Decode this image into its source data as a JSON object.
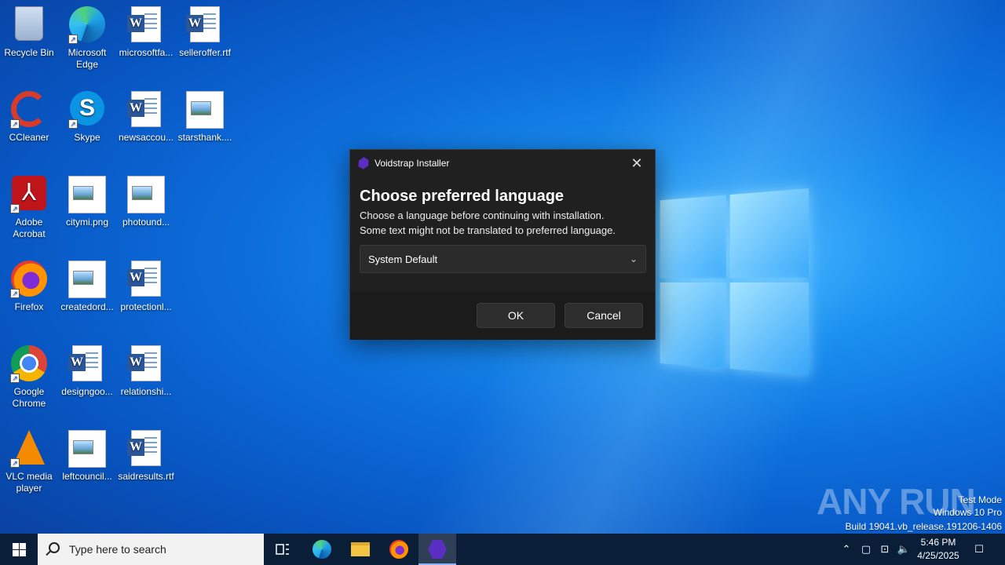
{
  "desktop": {
    "icons": [
      {
        "label": "Recycle Bin",
        "type": "recycle-bin-icon"
      },
      {
        "label": "Microsoft Edge",
        "type": "edge-icon"
      },
      {
        "label": "microsoftfa...",
        "type": "word-document-icon"
      },
      {
        "label": "selleroffer.rtf",
        "type": "word-document-icon"
      },
      {
        "label": "CCleaner",
        "type": "ccleaner-icon"
      },
      {
        "label": "Skype",
        "type": "skype-icon"
      },
      {
        "label": "newsaccou...",
        "type": "word-document-icon"
      },
      {
        "label": "starsthank....",
        "type": "image-file-icon"
      },
      {
        "label": "Adobe Acrobat",
        "type": "acrobat-icon"
      },
      {
        "label": "citymi.png",
        "type": "image-file-icon"
      },
      {
        "label": "photound...",
        "type": "image-file-icon"
      },
      {
        "label": "Firefox",
        "type": "firefox-icon"
      },
      {
        "label": "createdord...",
        "type": "image-file-icon"
      },
      {
        "label": "protectionl...",
        "type": "word-document-icon"
      },
      {
        "label": "Google Chrome",
        "type": "chrome-icon"
      },
      {
        "label": "designgoo...",
        "type": "word-document-icon"
      },
      {
        "label": "relationshi...",
        "type": "word-document-icon"
      },
      {
        "label": "VLC media player",
        "type": "vlc-icon"
      },
      {
        "label": "leftcouncil...",
        "type": "image-file-icon"
      },
      {
        "label": "saidresults.rtf",
        "type": "word-document-icon"
      }
    ]
  },
  "dialog": {
    "title": "Voidstrap Installer",
    "heading": "Choose preferred language",
    "line1": "Choose a language before continuing with installation.",
    "line2": "Some text might not be translated to preferred language.",
    "language_select": "System Default",
    "ok_label": "OK",
    "cancel_label": "Cancel"
  },
  "watermark": {
    "brand": "ANY RUN",
    "test_mode": "Test Mode",
    "edition": "Windows 10 Pro",
    "build": "Build 19041.vb_release.191206-1406"
  },
  "taskbar": {
    "search_placeholder": "Type here to search",
    "time": "5:46 PM",
    "date": "4/25/2025"
  },
  "colors": {
    "desktop_blue": "#0d6fdc",
    "dialog_bg": "#202020",
    "taskbar_bg": "#0b1e38",
    "voidstrap_accent": "#5b2ec2"
  }
}
